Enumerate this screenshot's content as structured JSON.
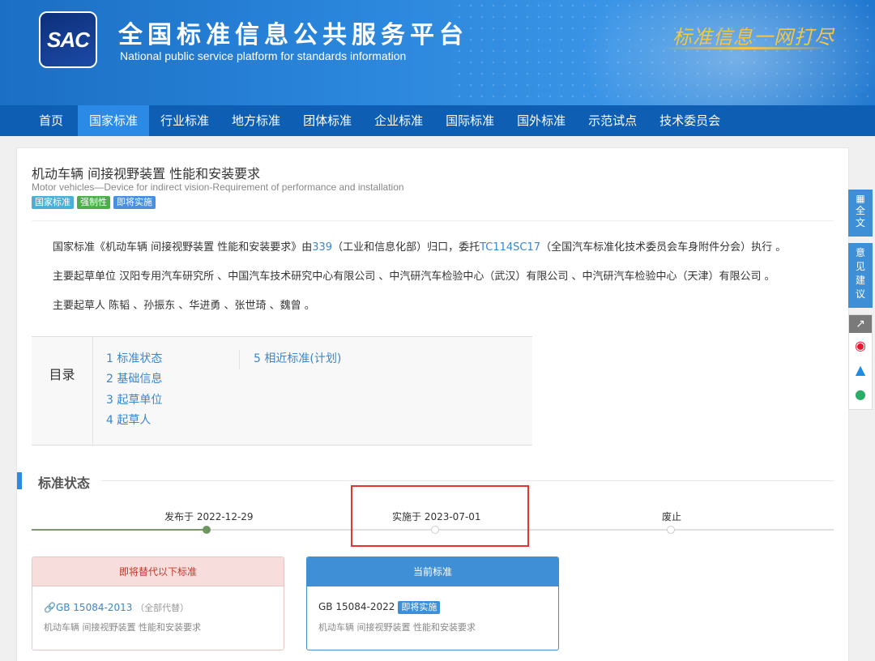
{
  "header": {
    "logo_text": "SAC",
    "title": "全国标准信息公共服务平台",
    "subtitle": "National public service platform  for standards information",
    "slogan": "标准信息一网打尽"
  },
  "nav": {
    "items": [
      "首页",
      "国家标准",
      "行业标准",
      "地方标准",
      "团体标准",
      "企业标准",
      "国际标准",
      "国外标准",
      "示范试点",
      "技术委员会"
    ],
    "active_index": 1
  },
  "standard": {
    "title": "机动车辆 间接视野装置 性能和安装要求",
    "title_en": "Motor vehicles—Device for indirect vision-Requirement of performance and installation",
    "tags": [
      "国家标准",
      "强制性",
      "即将实施"
    ],
    "para1_prefix": "国家标准《机动车辆 间接视野装置 性能和安装要求》由",
    "para1_link1": "339",
    "para1_mid": "（工业和信息化部）归口，委托",
    "para1_link2": "TC114SC17",
    "para1_suffix": "（全国汽车标准化技术委员会车身附件分会）执行 。",
    "para2": "主要起草单位 汉阳专用汽车研究所 、中国汽车技术研究中心有限公司 、中汽研汽车检验中心（武汉）有限公司 、中汽研汽车检验中心（天津）有限公司 。",
    "para3": "主要起草人 陈韬 、孙振东 、华进勇 、张世琦 、魏曾 。"
  },
  "toc": {
    "label": "目录",
    "items": [
      "1  标准状态",
      "2  基础信息",
      "3  起草单位",
      "4  起草人",
      "5  相近标准(计划)"
    ]
  },
  "status": {
    "section_title": "标准状态",
    "published": "发布于 2022-12-29",
    "implemented": "实施于 2023-07-01",
    "abolished": "废止",
    "progress_stage": 1
  },
  "replace_box": {
    "header": "即将替代以下标准",
    "code": "GB 15084-2013",
    "note": "（全部代替）",
    "desc": "机动车辆 间接视野装置 性能和安装要求"
  },
  "current_box": {
    "header": "当前标准",
    "code": "GB 15084-2022",
    "badge": "即将实施",
    "desc": "机动车辆 间接视野装置 性能和安装要求"
  },
  "float_bar": {
    "full_text": "全文",
    "advice": "意见建议"
  }
}
